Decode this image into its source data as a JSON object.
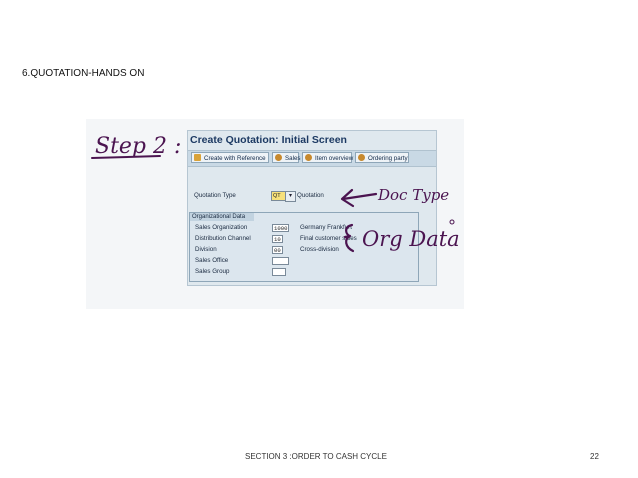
{
  "slide": {
    "title": "6.QUOTATION-HANDS ON",
    "footer": "SECTION 3 :ORDER TO CASH CYCLE",
    "page_number": "22"
  },
  "sap_window": {
    "title": "Create Quotation: Initial Screen",
    "toolbar": [
      {
        "label": "Create with Reference",
        "icon": "reference-icon"
      },
      {
        "label": "Sales",
        "icon": "person-icon"
      },
      {
        "label": "Item overview",
        "icon": "person-icon"
      },
      {
        "label": "Ordering party",
        "icon": "person-icon"
      }
    ],
    "quotation_type": {
      "label": "Quotation Type",
      "value": "QT",
      "description": "Quotation"
    },
    "org_data": {
      "heading": "Organizational Data",
      "rows": [
        {
          "label": "Sales Organization",
          "value": "1000",
          "description": "Germany Frankfurt"
        },
        {
          "label": "Distribution Channel",
          "value": "10",
          "description": "Final customer sales"
        },
        {
          "label": "Division",
          "value": "00",
          "description": "Cross-division"
        },
        {
          "label": "Sales Office",
          "value": "",
          "description": ""
        },
        {
          "label": "Sales Group",
          "value": "",
          "description": ""
        }
      ]
    }
  },
  "handwriting": {
    "step": "Step 2 :",
    "doc_type": "Doc Type",
    "org_data": "Org Data"
  },
  "colors": {
    "handwriting_ink": "#4b1450",
    "window_title": "#1d3a63",
    "field_highlight": "#f7e07a"
  }
}
